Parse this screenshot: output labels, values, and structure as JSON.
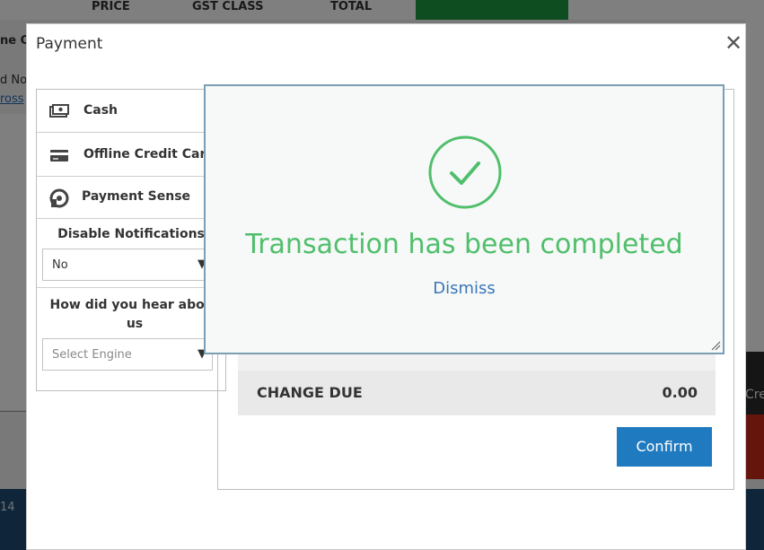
{
  "background": {
    "headers": [
      "PRICE",
      "GST CLASS",
      "TOTAL"
    ],
    "left_fragments": [
      "ne C",
      "d No",
      "ross"
    ],
    "bottom_date": "14",
    "right_fragment": "Cre"
  },
  "payment_modal": {
    "title": "Payment",
    "close_icon": "✕",
    "methods": [
      {
        "label": "Cash",
        "icon": "cash-icon"
      },
      {
        "label": "Offline Credit Card",
        "icon": "credit-card-icon"
      },
      {
        "label": "Payment Sense",
        "icon": "payment-sense-icon"
      }
    ],
    "notifications": {
      "label": "Disable Notifications",
      "value": "No"
    },
    "referral": {
      "label": "How did you hear about us",
      "placeholder": "Select Engine"
    },
    "change_due": {
      "label": "CHANGE DUE",
      "value": "0.00"
    },
    "confirm_label": "Confirm"
  },
  "success_dialog": {
    "message": "Transaction has been completed",
    "dismiss_label": "Dismiss",
    "accent_color": "#4fbf6b"
  },
  "colors": {
    "primary": "#1f7abf",
    "link": "#3a78b8",
    "success": "#4fbf6b"
  }
}
